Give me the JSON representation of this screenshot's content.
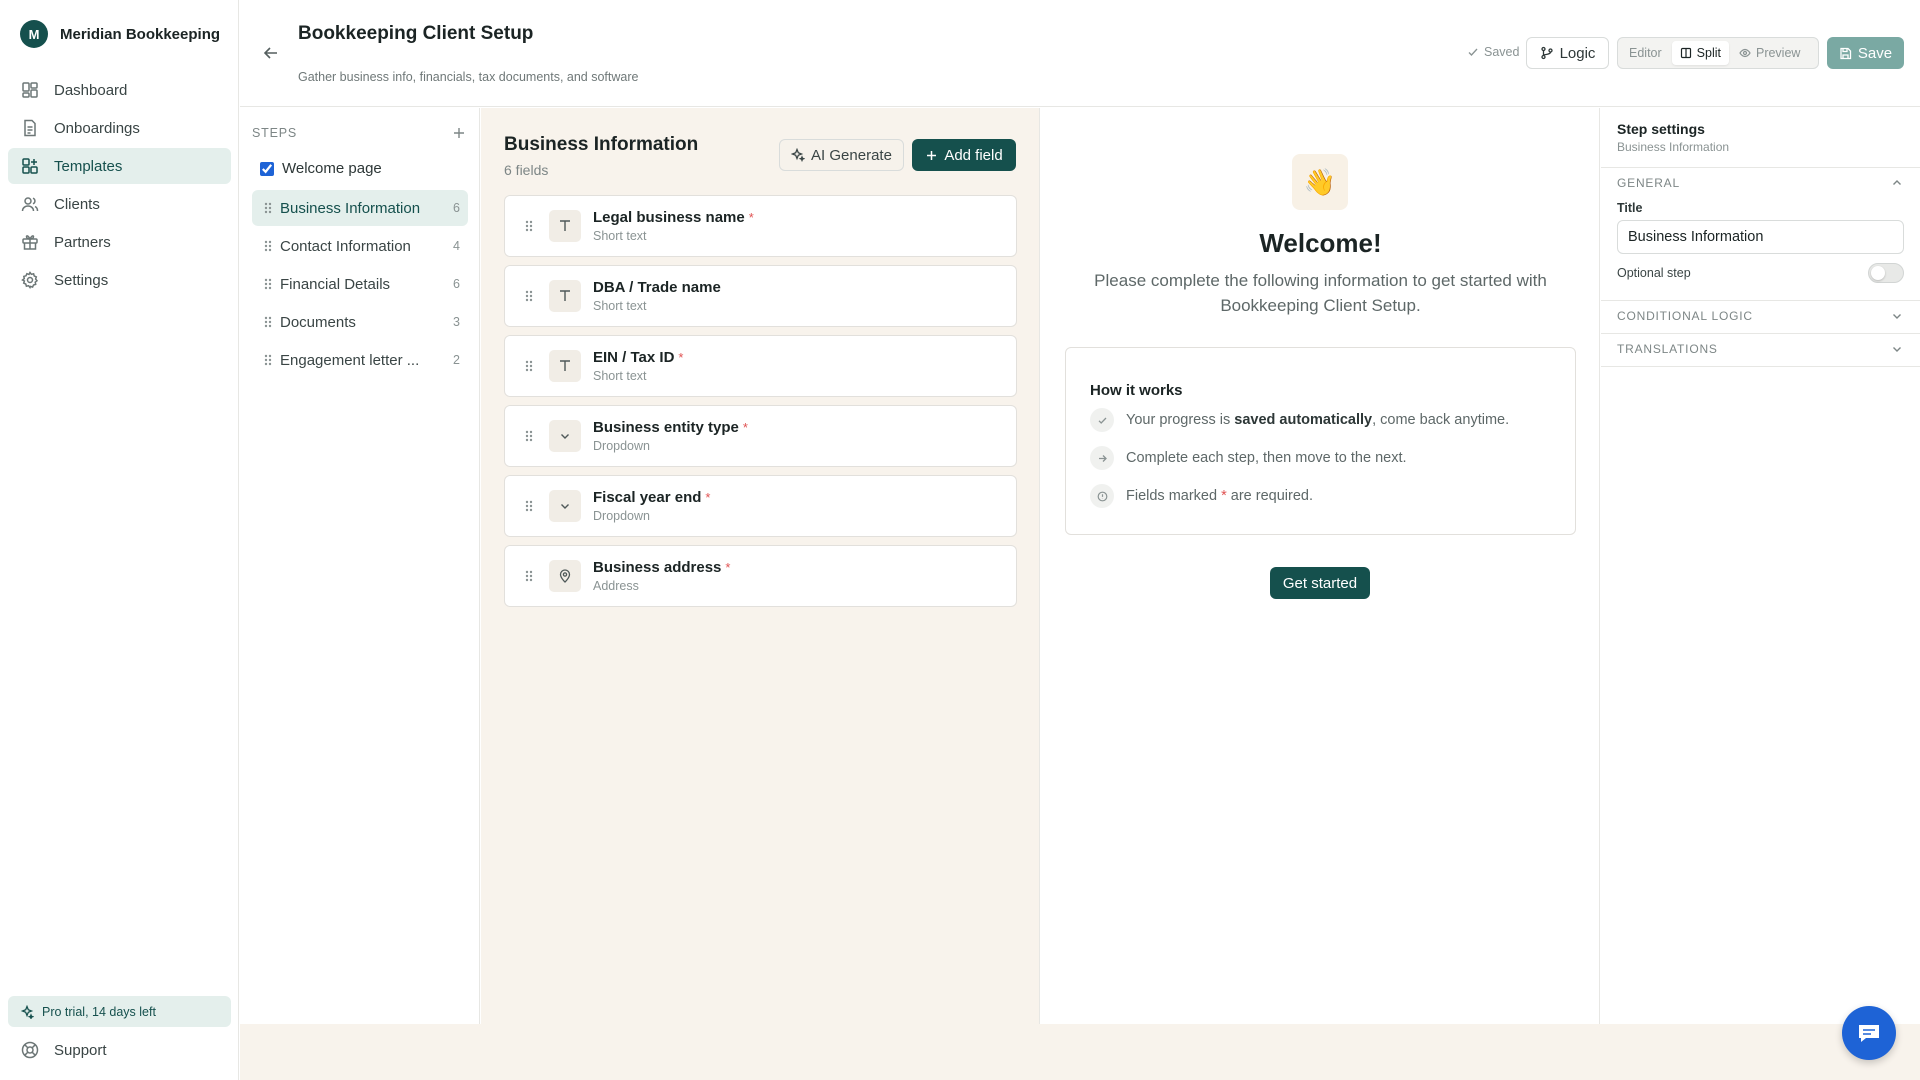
{
  "app": {
    "brand_initial": "M",
    "brand_name": "Meridian Bookkeeping",
    "accent": "#15504d"
  },
  "sidebar": {
    "items": [
      {
        "label": "Dashboard",
        "icon": "dashboard-icon"
      },
      {
        "label": "Onboardings",
        "icon": "document-icon"
      },
      {
        "label": "Templates",
        "icon": "templates-icon",
        "active": true
      },
      {
        "label": "Clients",
        "icon": "users-icon"
      },
      {
        "label": "Partners",
        "icon": "gift-icon"
      },
      {
        "label": "Settings",
        "icon": "gear-icon"
      }
    ],
    "trial": "Pro trial, 14 days left",
    "support": "Support"
  },
  "header": {
    "title": "Bookkeeping Client Setup",
    "subtitle": "Gather business info, financials, tax documents, and software",
    "saved": "Saved",
    "logic": "Logic",
    "modes": [
      "Editor",
      "Split",
      "Preview"
    ],
    "active_mode": "Split",
    "save": "Save"
  },
  "steps": {
    "label": "STEPS",
    "welcome": "Welcome page",
    "welcome_checked": true,
    "items": [
      {
        "name": "Business Information",
        "count": "6",
        "active": true
      },
      {
        "name": "Contact Information",
        "count": "4"
      },
      {
        "name": "Financial Details",
        "count": "6"
      },
      {
        "name": "Documents",
        "count": "3"
      },
      {
        "name": "Engagement letter ...",
        "count": "2"
      }
    ]
  },
  "editor": {
    "title": "Business Information",
    "subtitle": "6 fields",
    "ai_generate": "AI Generate",
    "add_field": "Add field",
    "fields": [
      {
        "name": "Legal business name",
        "type": "Short text",
        "required": true,
        "icon": "text-icon"
      },
      {
        "name": "DBA / Trade name",
        "type": "Short text",
        "required": false,
        "icon": "text-icon"
      },
      {
        "name": "EIN / Tax ID",
        "type": "Short text",
        "required": true,
        "icon": "text-icon"
      },
      {
        "name": "Business entity type",
        "type": "Dropdown",
        "required": true,
        "icon": "chevron-down-icon"
      },
      {
        "name": "Fiscal year end",
        "type": "Dropdown",
        "required": true,
        "icon": "chevron-down-icon"
      },
      {
        "name": "Business address",
        "type": "Address",
        "required": true,
        "icon": "map-pin-icon"
      }
    ]
  },
  "preview": {
    "emoji": "👋",
    "title": "Welcome!",
    "text": "Please complete the following information to get started with Bookkeeping Client Setup.",
    "how_title": "How it works",
    "how_1_pre": "Your progress is ",
    "how_1_bold": "saved automatically",
    "how_1_post": ", come back anytime.",
    "how_2": "Complete each step, then move to the next.",
    "how_3_pre": "Fields marked ",
    "how_3_star": "*",
    "how_3_post": " are required.",
    "button": "Get started"
  },
  "settings": {
    "title": "Step settings",
    "subtitle": "Business Information",
    "general": "GENERAL",
    "title_label": "Title",
    "title_value": "Business Information",
    "optional": "Optional step",
    "optional_on": false,
    "conditional": "CONDITIONAL LOGIC",
    "translations": "TRANSLATIONS"
  }
}
